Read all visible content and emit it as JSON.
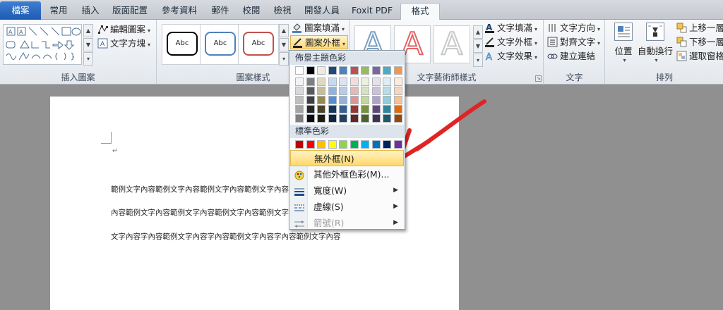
{
  "tabs": [
    {
      "label": "檔案"
    },
    {
      "label": "常用"
    },
    {
      "label": "插入"
    },
    {
      "label": "版面配置"
    },
    {
      "label": "參考資料"
    },
    {
      "label": "郵件"
    },
    {
      "label": "校閱"
    },
    {
      "label": "檢視"
    },
    {
      "label": "開發人員"
    },
    {
      "label": "Foxit PDF"
    },
    {
      "label": "格式"
    }
  ],
  "ribbon": {
    "insert_shapes": {
      "label": "插入圖案",
      "edit_shape": "編輯圖案",
      "text_box": "文字方塊"
    },
    "shape_styles": {
      "label": "圖案樣式",
      "thumb_text": "Abc",
      "shape_fill": "圖案填滿",
      "shape_outline": "圖案外框"
    },
    "wordart_styles": {
      "label": "文字藝術師樣式",
      "letter": "A",
      "text_fill": "文字填滿",
      "text_outline": "文字外框",
      "text_effects": "文字效果"
    },
    "text": {
      "label": "文字",
      "text_direction": "文字方向",
      "align_text": "對齊文字",
      "create_link": "建立連結"
    },
    "arrange": {
      "label": "排列",
      "position": "位置",
      "wrap_text": "自動換行",
      "bring_forward": "上移一層",
      "send_backward": "下移一層",
      "selection_pane": "選取窗格"
    }
  },
  "document": {
    "lines": [
      "範例文字內容範例文字內容範例文字內容範例文字內容",
      "內容範例文字內容範例文字內容範例文字內容範例文字",
      "文字內容字內容範例文字內容字內容範例文字內容字內容範例文字內容"
    ]
  },
  "dropdown": {
    "theme_colors_header": "佈景主題色彩",
    "standard_colors_header": "標準色彩",
    "theme_top_row": [
      "#ffffff",
      "#000000",
      "#eeece1",
      "#1f497d",
      "#4f81bd",
      "#c0504d",
      "#9bbb59",
      "#8064a2",
      "#4bacc6",
      "#f79646"
    ],
    "theme_shades": [
      [
        "#f2f2f2",
        "#7f7f7f",
        "#ddd9c3",
        "#c6d9f0",
        "#dbe5f1",
        "#f2dcdb",
        "#ebf1dd",
        "#e5e0ec",
        "#dbeef3",
        "#fdeada"
      ],
      [
        "#d8d8d8",
        "#595959",
        "#c4bd97",
        "#8db3e2",
        "#b8cce4",
        "#e5b9b7",
        "#d7e3bc",
        "#ccc1d9",
        "#b7dde8",
        "#fbd5b5"
      ],
      [
        "#bfbfbf",
        "#3f3f3f",
        "#938953",
        "#548dd4",
        "#95b3d7",
        "#d99694",
        "#c3d69b",
        "#b2a2c7",
        "#92cddc",
        "#fac08f"
      ],
      [
        "#a5a5a5",
        "#262626",
        "#494429",
        "#17365d",
        "#366092",
        "#953734",
        "#76923c",
        "#5f497a",
        "#31859b",
        "#e36c09"
      ],
      [
        "#7f7f7f",
        "#0c0c0c",
        "#1d1b10",
        "#0f243e",
        "#244061",
        "#632423",
        "#4f6128",
        "#3f3151",
        "#205867",
        "#974806"
      ]
    ],
    "standard_colors": [
      "#c00000",
      "#ff0000",
      "#ffc000",
      "#ffff00",
      "#92d050",
      "#00b050",
      "#00b0f0",
      "#0070c0",
      "#002060",
      "#7030a0"
    ],
    "no_outline": "無外框(N)",
    "more_colors": "其他外框色彩(M)...",
    "weight": "寬度(W)",
    "dashes": "虛線(S)",
    "arrows": "箭號(R)"
  },
  "colors": {
    "accent_red": "#e02424",
    "highlight": "#ffd86a",
    "file_tab": "#2a66c0"
  }
}
